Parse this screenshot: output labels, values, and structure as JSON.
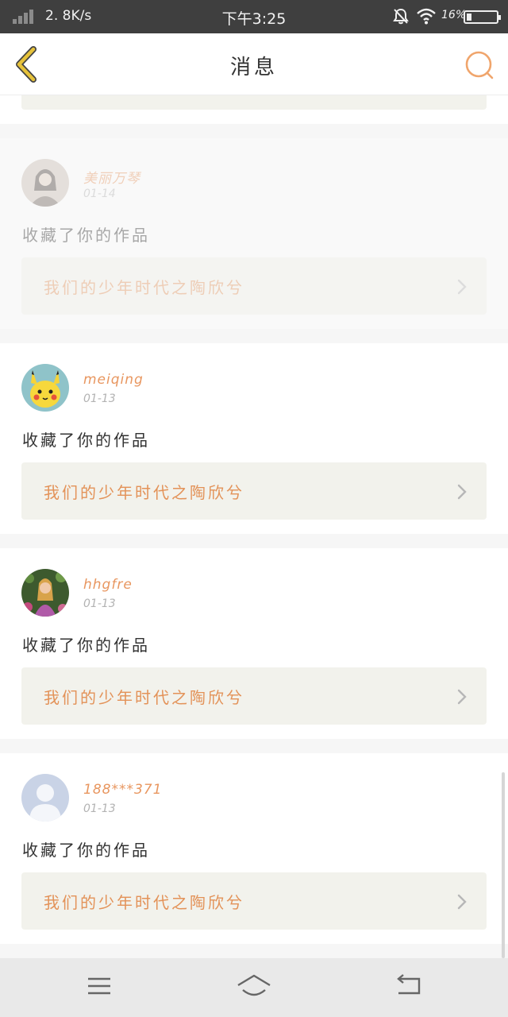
{
  "status_bar": {
    "net_speed": "2. 8K/s",
    "time": "下午3:25",
    "battery_text": "16%"
  },
  "header": {
    "title": "消息",
    "back_icon": "chevron-left-icon",
    "search_icon": "search-icon"
  },
  "messages": [
    {
      "username": "美丽万琴",
      "date": "01-14",
      "action": "收藏了你的作品",
      "work_title": "我们的少年时代之陶欣兮",
      "avatar_icon": "avatar-photo-woman"
    },
    {
      "username": "meiqing",
      "date": "01-13",
      "action": "收藏了你的作品",
      "work_title": "我们的少年时代之陶欣兮",
      "avatar_icon": "avatar-pikachu"
    },
    {
      "username": "hhgfre",
      "date": "01-13",
      "action": "收藏了你的作品",
      "work_title": "我们的少年时代之陶欣兮",
      "avatar_icon": "avatar-photo-flowers"
    },
    {
      "username": "188***371",
      "date": "01-13",
      "action": "收藏了你的作品",
      "work_title": "我们的少年时代之陶欣兮",
      "avatar_icon": "avatar-default"
    }
  ],
  "nav": {
    "menu_icon": "menu-icon",
    "home_icon": "home-icon",
    "back_icon": "back-icon"
  },
  "colors": {
    "accent": "#e8965f",
    "back_arrow": "#e6c23a",
    "card_link_bg": "#f2f2ec"
  }
}
